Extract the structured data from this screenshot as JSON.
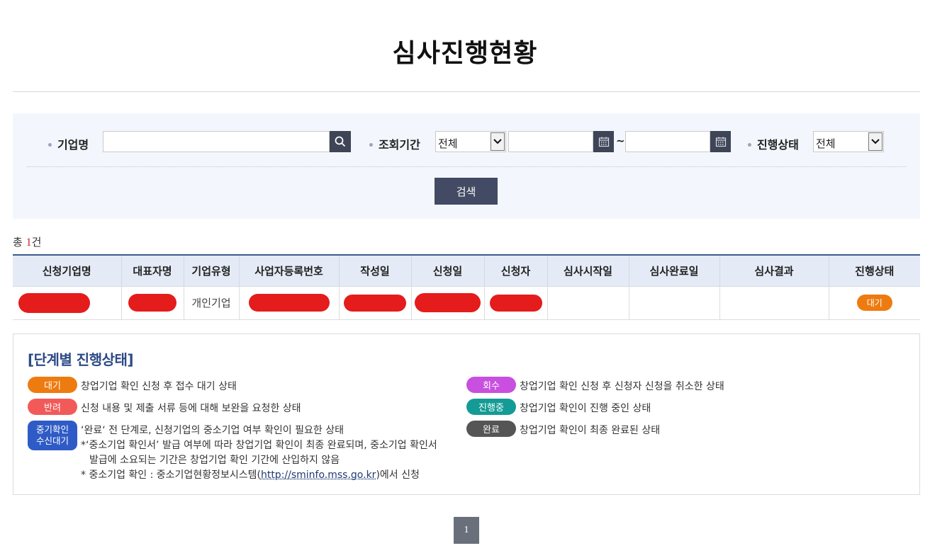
{
  "page": {
    "title": "심사진행현황"
  },
  "search": {
    "company_label": "기업명",
    "company_value": "",
    "period_label": "조회기간",
    "period_select": "전체",
    "date_from": "",
    "date_to": "",
    "tilde": "~",
    "status_label": "진행상태",
    "status_select": "전체",
    "search_button": "검색"
  },
  "summary": {
    "prefix": "총 ",
    "count": "1",
    "suffix": "건"
  },
  "table": {
    "headers": [
      "신청기업명",
      "대표자명",
      "기업유형",
      "사업자등록번호",
      "작성일",
      "신청일",
      "신청자",
      "심사시작일",
      "심사완료일",
      "심사결과",
      "진행상태"
    ],
    "rows": [
      {
        "company_type": "개인기업",
        "status": "대기",
        "status_color": "#ee7b10"
      }
    ]
  },
  "legend": {
    "title": "[단계별 진행상태]",
    "items": [
      {
        "badge": "대기",
        "color": "#ee7b10",
        "desc": "창업기업 확인 신청 후 접수 대기 상태"
      },
      {
        "badge": "반려",
        "color": "#f25a5a",
        "desc": "신청 내용 및 제출 서류 등에 대해 보완을 요청한 상태"
      },
      {
        "badge": "회수",
        "color": "#c84fe0",
        "desc": "창업기업 확인 신청 후 신청자 신청을 취소한 상태"
      },
      {
        "badge": "진행중",
        "color": "#159b95",
        "desc": "창업기업 확인이 진행 중인 상태"
      },
      {
        "badge": "완료",
        "color": "#555555",
        "desc": "창업기업 확인이 최종 완료된 상태"
      }
    ],
    "multi": {
      "badge_line1": "중기확인",
      "badge_line2": "수신대기",
      "color": "#2f5bc6",
      "line1": "‘완료‘ 전 단계로, 신청기업의 중소기업 여부 확인이 필요한 상태",
      "line2": "*‘중소기업 확인서’ 발급 여부에 따라 창업기업 확인이 최종 완료되며, 중소기업 확인서",
      "line3": "발급에 소요되는 기간은 창업기업 확인 기간에 산입하지 않음",
      "line4_prefix": "* 중소기업 확인 : 중소기업현황정보시스템(",
      "line4_link": "http://sminfo.mss.go.kr",
      "line4_suffix": ")에서 신청"
    }
  },
  "pagination": {
    "current": "1"
  }
}
